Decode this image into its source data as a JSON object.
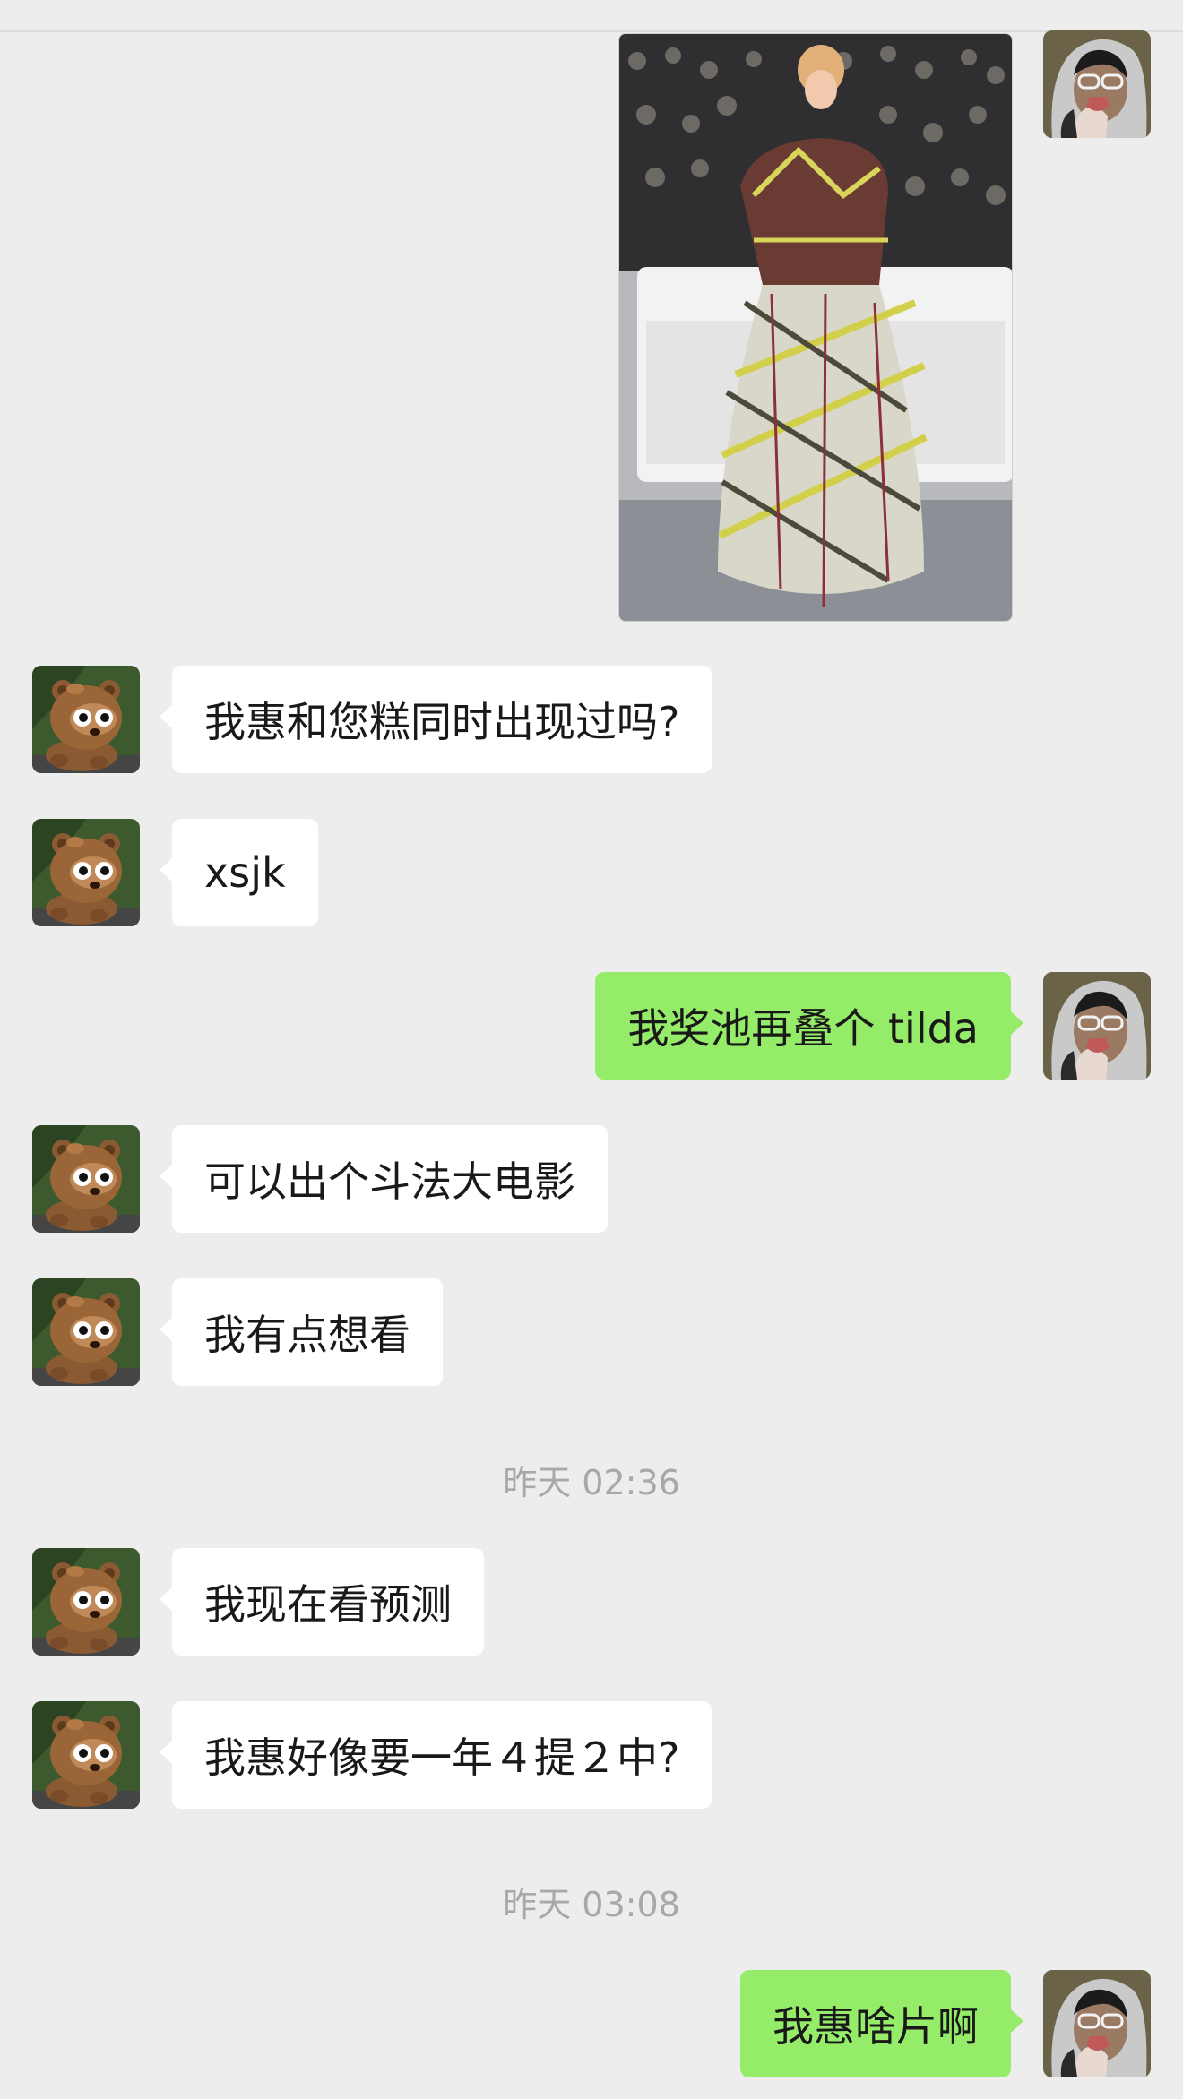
{
  "messages": [
    {
      "from": "other",
      "text": "我惠和您糕同时出现过吗?"
    },
    {
      "from": "other",
      "text": "xsjk"
    },
    {
      "from": "me",
      "text": "我奖池再叠个 tilda"
    },
    {
      "from": "other",
      "text": "可以出个斗法大电影"
    },
    {
      "from": "other",
      "text": "我有点想看"
    },
    {
      "from": "other",
      "text": "我现在看预测"
    },
    {
      "from": "other",
      "text": "我惠好像要一年４提２中?"
    },
    {
      "from": "me",
      "text": "我惠啥片啊"
    }
  ],
  "timestamps": [
    "昨天 02:36",
    "昨天 03:08"
  ],
  "colors": {
    "background": "#ededed",
    "incoming_bubble": "#ffffff",
    "outgoing_bubble": "#95ec69",
    "timestamp_text": "#a8a8a8"
  },
  "icons": {
    "other_avatar": "bear-cartoon-avatar",
    "my_avatar": "hooded-person-avatar"
  }
}
